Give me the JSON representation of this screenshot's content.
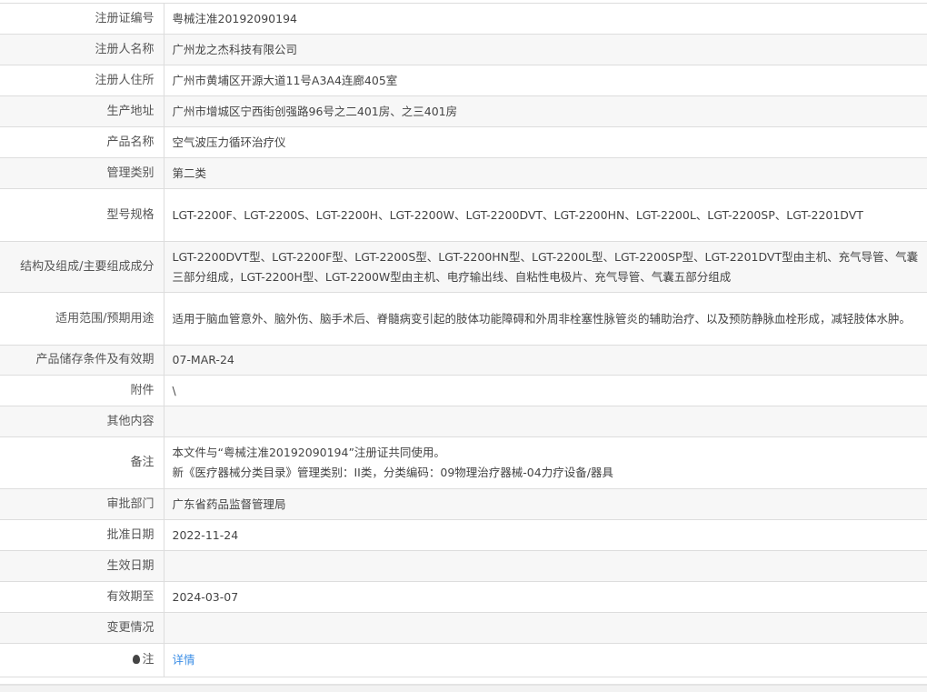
{
  "rows": [
    {
      "label": "注册证编号",
      "value": "粤械注准20192090194"
    },
    {
      "label": "注册人名称",
      "value": "广州龙之杰科技有限公司"
    },
    {
      "label": "注册人住所",
      "value": "广州市黄埔区开源大道11号A3A4连廊405室"
    },
    {
      "label": "生产地址",
      "value": "广州市增城区宁西街创强路96号之二401房、之三401房"
    },
    {
      "label": "产品名称",
      "value": "空气波压力循环治疗仪"
    },
    {
      "label": "管理类别",
      "value": "第二类"
    },
    {
      "label": "型号规格",
      "value": "LGT-2200F、LGT-2200S、LGT-2200H、LGT-2200W、LGT-2200DVT、LGT-2200HN、LGT-2200L、LGT-2200SP、LGT-2201DVT"
    },
    {
      "label": "结构及组成/主要组成成分",
      "value": "LGT-2200DVT型、LGT-2200F型、LGT-2200S型、LGT-2200HN型、LGT-2200L型、LGT-2200SP型、LGT-2201DVT型由主机、充气导管、气囊三部分组成，LGT-2200H型、LGT-2200W型由主机、电疗输出线、自粘性电极片、充气导管、气囊五部分组成"
    },
    {
      "label": "适用范围/预期用途",
      "value": "适用于脑血管意外、脑外伤、脑手术后、脊髓病变引起的肢体功能障碍和外周非栓塞性脉管炎的辅助治疗、以及预防静脉血栓形成，减轻肢体水肿。"
    },
    {
      "label": "产品储存条件及有效期",
      "value": "07-MAR-24"
    },
    {
      "label": "附件",
      "value": "\\"
    },
    {
      "label": "其他内容",
      "value": ""
    },
    {
      "label": "备注",
      "value": "本文件与“粤械注准20192090194”注册证共同使用。",
      "value2": "新《医疗器械分类目录》管理类别：II类，分类编码：09物理治疗器械-04力疗设备/器具"
    },
    {
      "label": "审批部门",
      "value": "广东省药品监督管理局"
    },
    {
      "label": "批准日期",
      "value": "2022-11-24"
    },
    {
      "label": "生效日期",
      "value": ""
    },
    {
      "label": "有效期至",
      "value": "2024-03-07"
    },
    {
      "label": "变更情况",
      "value": ""
    }
  ],
  "note": {
    "label": "注",
    "link": "详情",
    "icon": "lightbulb-icon"
  }
}
